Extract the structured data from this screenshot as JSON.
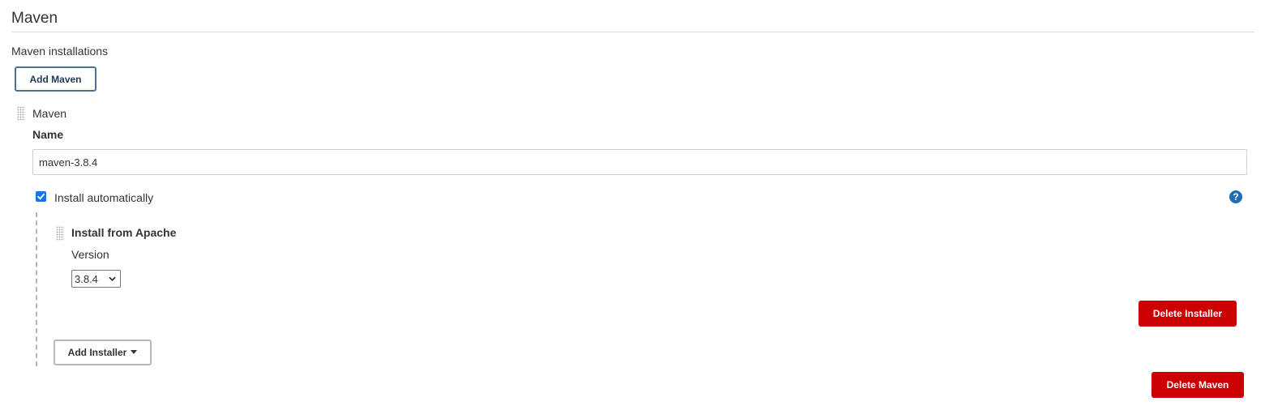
{
  "section": {
    "title": "Maven",
    "group_label": "Maven installations",
    "add_button_label": "Add Maven"
  },
  "installation": {
    "header": "Maven",
    "name_label": "Name",
    "name_value": "maven-3.8.4",
    "install_auto_label": "Install automatically",
    "install_auto_checked": true,
    "help_icon": "question-mark-icon",
    "installer": {
      "title": "Install from Apache",
      "version_label": "Version",
      "version_selected": "3.8.4",
      "delete_button_label": "Delete Installer"
    },
    "add_installer_label": "Add Installer",
    "delete_button_label": "Delete Maven"
  },
  "colors": {
    "danger": "#cc0003",
    "outline": "#4a7396",
    "help": "#1f6db5",
    "checkbox": "#1a73e8"
  }
}
